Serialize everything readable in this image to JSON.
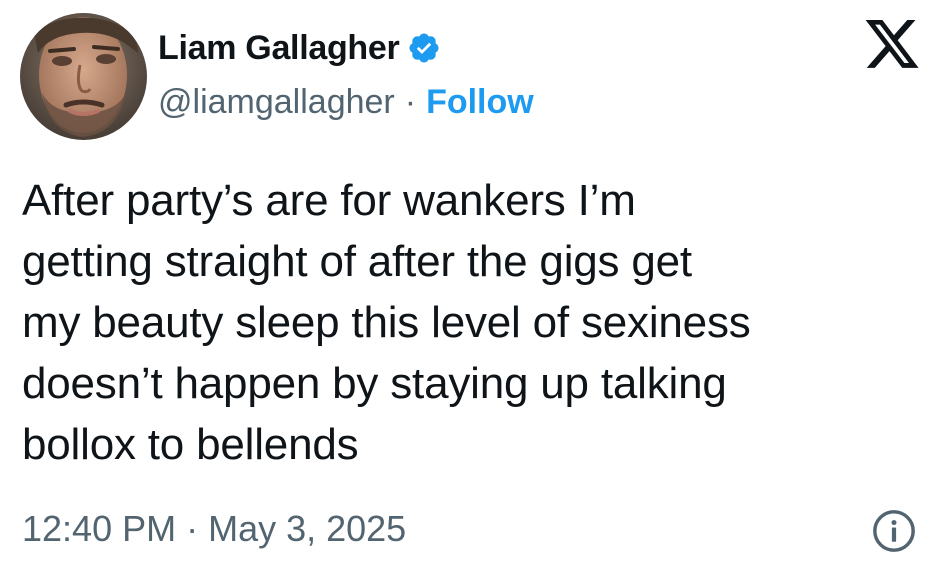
{
  "author": {
    "display_name": "Liam Gallagher",
    "handle": "@liamgallagher",
    "separator": "·",
    "follow_label": "Follow",
    "verified": true,
    "avatar_icon": "user-avatar"
  },
  "brand": {
    "logo_icon": "x-logo-icon"
  },
  "tweet": {
    "text": "After party’s are for wankers I’m\ngetting straight of after the gigs get\nmy beauty sleep this level of sexiness\ndoesn’t happen by staying up talking\nbollox to bellends",
    "timestamp": "12:40 PM · May 3, 2025",
    "info_icon": "info-icon"
  },
  "colors": {
    "text": "#0f1419",
    "secondary": "#536471",
    "accent": "#1d9bf0",
    "background": "#ffffff"
  }
}
